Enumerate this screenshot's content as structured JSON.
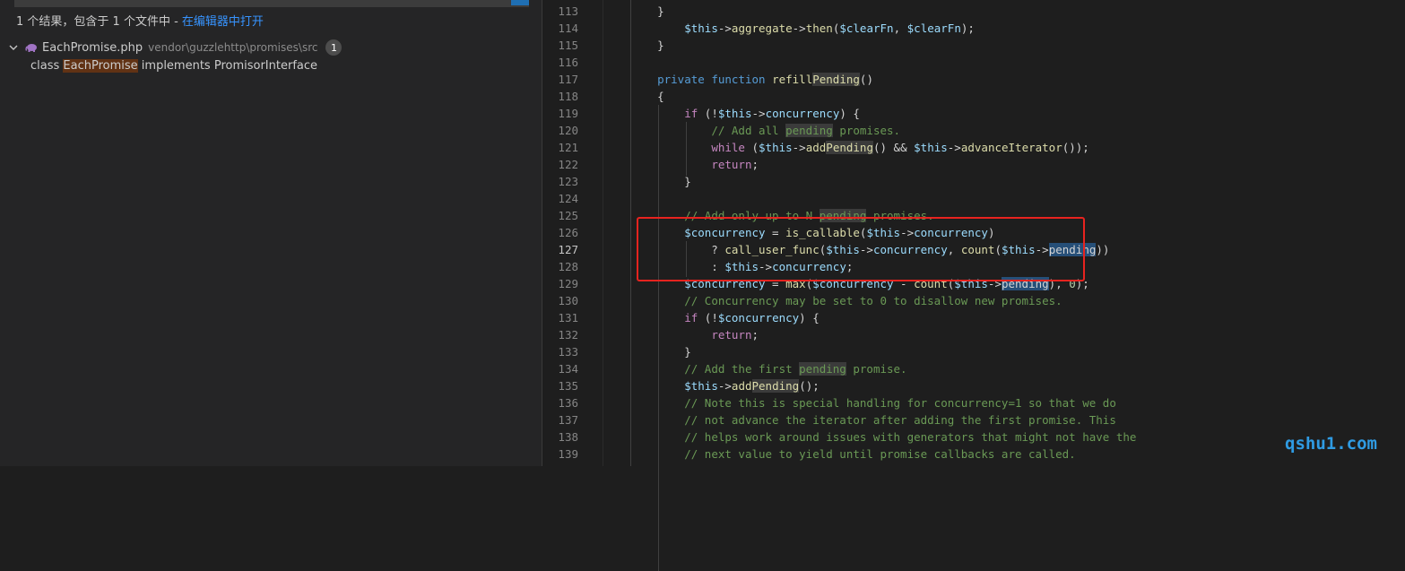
{
  "search": {
    "summary_prefix": "1 个结果，包含于 1 个文件中 - ",
    "open_in_editor": "在编辑器中打开",
    "file": {
      "name": "EachPromise.php",
      "path": "vendor\\guzzlehttp\\promises\\src",
      "count": "1"
    },
    "match": {
      "before": "class ",
      "highlight": "EachPromise",
      "after": " implements PromisorInterface"
    }
  },
  "editor": {
    "active_line": 127,
    "lines": [
      {
        "n": "113",
        "text": "    }"
      },
      {
        "n": "114",
        "text": "        $this->aggregate->then($clearFn, $clearFn);"
      },
      {
        "n": "115",
        "text": "    }"
      },
      {
        "n": "116",
        "text": ""
      },
      {
        "n": "117",
        "text": "    private function refillPending()"
      },
      {
        "n": "118",
        "text": "    {"
      },
      {
        "n": "119",
        "text": "        if (!$this->concurrency) {"
      },
      {
        "n": "120",
        "text": "            // Add all pending promises."
      },
      {
        "n": "121",
        "text": "            while ($this->addPending() && $this->advanceIterator());"
      },
      {
        "n": "122",
        "text": "            return;"
      },
      {
        "n": "123",
        "text": "        }"
      },
      {
        "n": "124",
        "text": ""
      },
      {
        "n": "125",
        "text": "        // Add only up to N pending promises."
      },
      {
        "n": "126",
        "text": "        $concurrency = is_callable($this->concurrency)"
      },
      {
        "n": "127",
        "text": "            ? call_user_func($this->concurrency, count($this->pending))"
      },
      {
        "n": "128",
        "text": "            : $this->concurrency;"
      },
      {
        "n": "129",
        "text": "        $concurrency = max($concurrency - count($this->pending), 0);"
      },
      {
        "n": "130",
        "text": "        // Concurrency may be set to 0 to disallow new promises."
      },
      {
        "n": "131",
        "text": "        if (!$concurrency) {"
      },
      {
        "n": "132",
        "text": "            return;"
      },
      {
        "n": "133",
        "text": "        }"
      },
      {
        "n": "134",
        "text": "        // Add the first pending promise."
      },
      {
        "n": "135",
        "text": "        $this->addPending();"
      },
      {
        "n": "136",
        "text": "        // Note this is special handling for concurrency=1 so that we do"
      },
      {
        "n": "137",
        "text": "        // not advance the iterator after adding the first promise. This"
      },
      {
        "n": "138",
        "text": "        // helps work around issues with generators that might not have the"
      },
      {
        "n": "139",
        "text": "        // next value to yield until promise callbacks are called."
      }
    ]
  },
  "watermark": "qshu1.com",
  "colors": {
    "accent": "#3794ff",
    "annotation": "#e8231f",
    "watermark": "#2f9be3"
  }
}
